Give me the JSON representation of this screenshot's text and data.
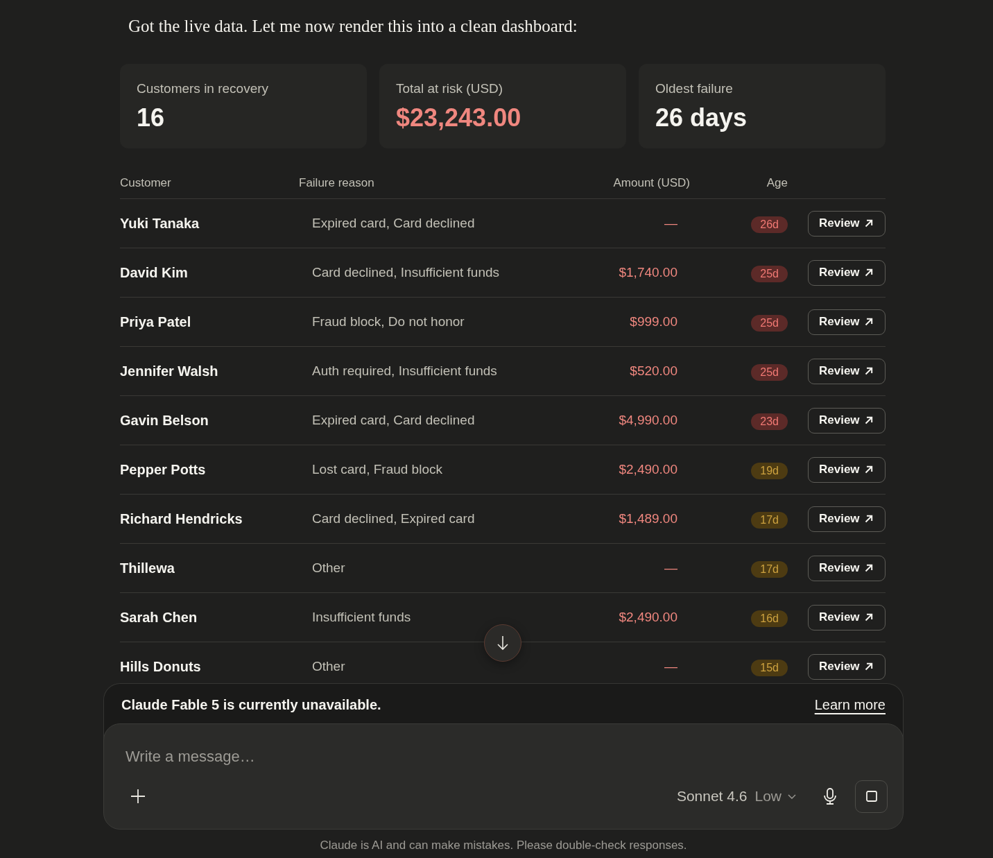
{
  "message": {
    "text": "Got the live data. Let me now render this into a clean dashboard:"
  },
  "stats": [
    {
      "label": "Customers in recovery",
      "value": "16",
      "highlight": false
    },
    {
      "label": "Total at risk (USD)",
      "value": "$23,243.00",
      "highlight": true
    },
    {
      "label": "Oldest failure",
      "value": "26 days",
      "highlight": false
    }
  ],
  "table": {
    "columns": [
      "Customer",
      "Failure reason",
      "Amount (USD)",
      "Age"
    ],
    "rows": [
      {
        "customer": "Yuki Tanaka",
        "reason": "Expired card, Card declined",
        "amount": "—",
        "age": "26d",
        "color": "#5c2a28",
        "action": "Review"
      },
      {
        "customer": "David Kim",
        "reason": "Card declined, Insufficient funds",
        "amount": "$1,740.00",
        "age": "25d",
        "color": "#5c2a28",
        "action": "Review"
      },
      {
        "customer": "Priya Patel",
        "reason": "Fraud block, Do not honor",
        "amount": "$999.00",
        "age": "25d",
        "color": "#5c2a28",
        "action": "Review"
      },
      {
        "customer": "Jennifer Walsh",
        "reason": "Auth required, Insufficient funds",
        "amount": "$520.00",
        "age": "25d",
        "color": "#5c2a28",
        "action": "Review"
      },
      {
        "customer": "Gavin Belson",
        "reason": "Expired card, Card declined",
        "amount": "$4,990.00",
        "age": "23d",
        "color": "#5c2a28",
        "action": "Review"
      },
      {
        "customer": "Pepper Potts",
        "reason": "Lost card, Fraud block",
        "amount": "$2,490.00",
        "age": "19d",
        "color": "#4d3b12",
        "action": "Review"
      },
      {
        "customer": "Richard Hendricks",
        "reason": "Card declined, Expired card",
        "amount": "$1,489.00",
        "age": "17d",
        "color": "#4d3b12",
        "action": "Review"
      },
      {
        "customer": "Thillewa",
        "reason": "Other",
        "amount": "—",
        "age": "17d",
        "color": "#4d3b12",
        "action": "Review"
      },
      {
        "customer": "Sarah Chen",
        "reason": "Insufficient funds",
        "amount": "$2,490.00",
        "age": "16d",
        "color": "#4d3b12",
        "action": "Review"
      },
      {
        "customer": "Hills Donuts",
        "reason": "Other",
        "amount": "—",
        "age": "15d",
        "color": "#4d3b12",
        "action": "Review"
      }
    ]
  },
  "notice": {
    "text": "Claude Fable 5 is currently unavailable.",
    "link": "Learn more"
  },
  "composer": {
    "placeholder": "Write a message…",
    "model": "Sonnet 4.6",
    "effort": "Low"
  },
  "footer": {
    "text": "Claude is AI and can make mistakes. Please double-check responses."
  }
}
